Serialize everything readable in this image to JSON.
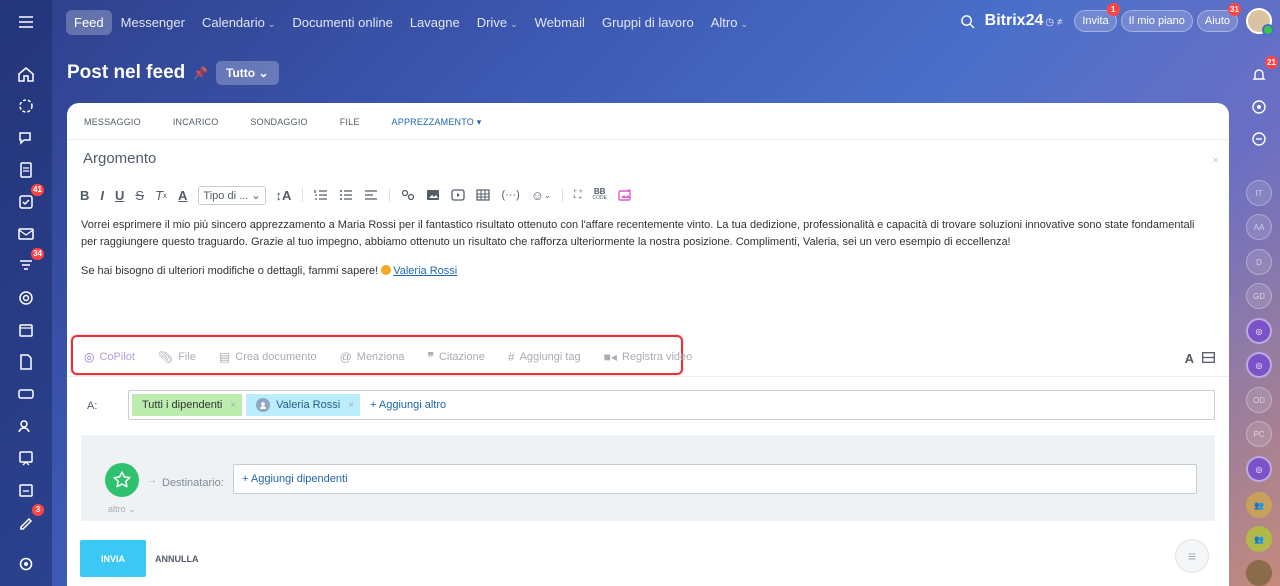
{
  "topbar": {
    "nav": [
      {
        "label": "Feed",
        "active": true,
        "chevron": false
      },
      {
        "label": "Messenger",
        "chevron": false
      },
      {
        "label": "Calendario",
        "chevron": true
      },
      {
        "label": "Documenti online",
        "chevron": false
      },
      {
        "label": "Lavagne",
        "chevron": false
      },
      {
        "label": "Drive",
        "chevron": true
      },
      {
        "label": "Webmail",
        "chevron": false
      },
      {
        "label": "Gruppi di lavoro",
        "chevron": false
      },
      {
        "label": "Altro",
        "chevron": true
      }
    ],
    "brand": "Bitrix",
    "brand_number": "24",
    "invite_label": "Invita",
    "invite_badge": "1",
    "plan_label": "Il mio piano",
    "help_label": "Aiuto",
    "help_badge": "31"
  },
  "leftrail": {
    "badges": {
      "tasks": "41",
      "feed": "34",
      "signs": "3"
    }
  },
  "rightrail": {
    "notifications_badge": "21",
    "avatars": [
      "IT",
      "AA",
      "D",
      "GD",
      "OD",
      "PC"
    ]
  },
  "page": {
    "title": "Post nel feed",
    "filter_label": "Tutto"
  },
  "editor": {
    "tabs": [
      {
        "label": "MESSAGGIO"
      },
      {
        "label": "INCARICO"
      },
      {
        "label": "SONDAGGIO"
      },
      {
        "label": "FILE"
      },
      {
        "label": "APPREZZAMENTO",
        "active": true
      }
    ],
    "subject_placeholder": "Argomento",
    "toolbar": {
      "format_select": "Tipo di ...",
      "bb_label": "BB"
    },
    "body_paragraph_1": "Vorrei esprimere il mio più sincero apprezzamento a Maria Rossi per il fantastico risultato ottenuto con l'affare recentemente vinto. La tua dedizione, professionalità e capacità di trovare soluzioni innovative sono state fondamentali per raggiungere questo traguardo. Grazie al tuo impegno, abbiamo ottenuto un risultato che rafforza ulteriormente la nostra posizione. Complimenti, Valeria, sei un vero esempio di eccellenza!",
    "body_paragraph_2": "Se hai bisogno di ulteriori modifiche o dettagli, fammi sapere!",
    "body_mention": "Valeria Rossi",
    "attachments": {
      "copilot": "CoPilot",
      "file": "File",
      "create_doc": "Crea documento",
      "mention": "Menziona",
      "quote": "Citazione",
      "tag": "Aggiungi tag",
      "video": "Registra video"
    },
    "to_label": "A:",
    "recipients": [
      {
        "label": "Tutti i dipendenti",
        "type": "group"
      },
      {
        "label": "Valeria Rossi",
        "type": "user"
      }
    ],
    "add_more": "+ Aggiungi altro",
    "recipient_label": "Destinatario:",
    "add_employees": "+ Aggiungi dipendenti",
    "badge_more": "altro",
    "send_label": "INVIA",
    "cancel_label": "ANNULLA"
  },
  "colors": {
    "accent": "#2067b0",
    "send": "#3bc8f5",
    "highlight_border": "#e8303a",
    "badge_green": "#2fc26e"
  }
}
